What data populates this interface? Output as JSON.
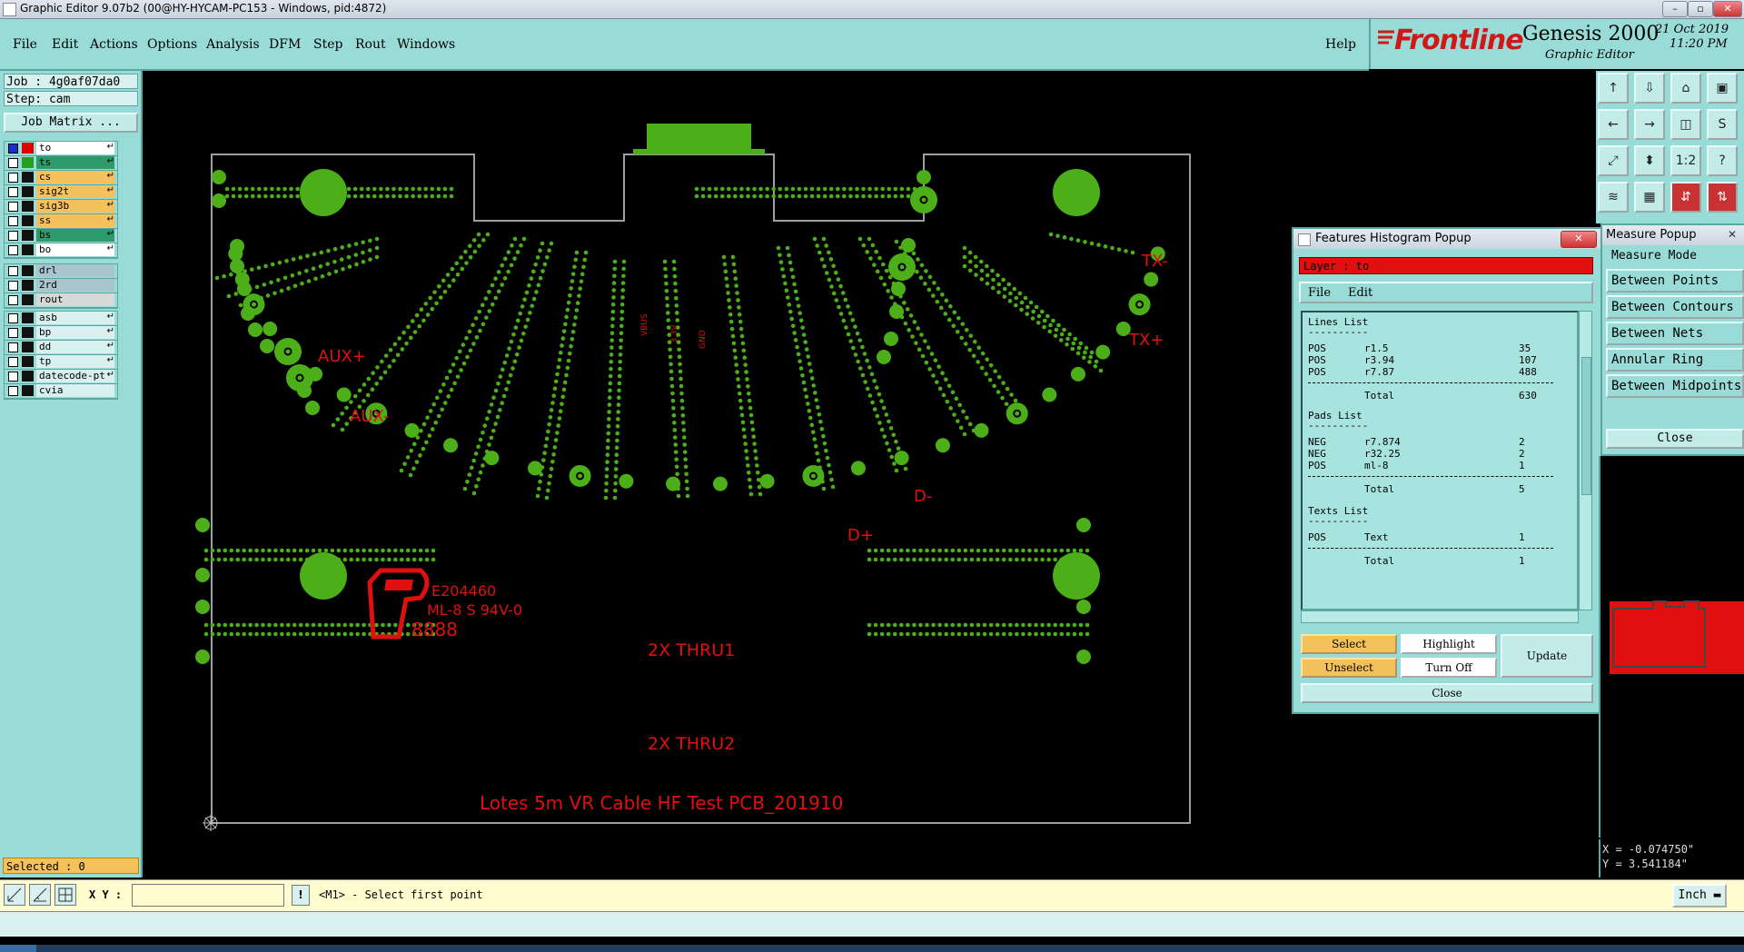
{
  "window": {
    "title": "Graphic Editor 9.07b2 (00@HY-HYCAM-PC153 - Windows, pid:4872)"
  },
  "menu": {
    "items": [
      "File",
      "Edit",
      "Actions",
      "Options",
      "Analysis",
      "DFM",
      "Step",
      "Rout",
      "Windows"
    ],
    "help": "Help"
  },
  "brand": {
    "logo": "Frontline",
    "product": "Genesis 2000",
    "subtitle": "Graphic Editor",
    "date": "21 Oct 2019",
    "time": "11:20 PM"
  },
  "left": {
    "job": "Job : 4g0af07da0",
    "step": "Step: cam",
    "job_matrix": "Job Matrix ...",
    "layers_group1": [
      {
        "name": "to",
        "color": "#ffffff",
        "swatch": "#e00000",
        "first": true
      },
      {
        "name": "ts",
        "color": "#2e9a6a",
        "swatch": "#22a022"
      },
      {
        "name": "cs",
        "color": "#f5c15a",
        "swatch": "#111111"
      },
      {
        "name": "sig2t",
        "color": "#f5c15a",
        "swatch": "#111111"
      },
      {
        "name": "sig3b",
        "color": "#f5c15a",
        "swatch": "#111111"
      },
      {
        "name": "ss",
        "color": "#f5c15a",
        "swatch": "#111111"
      },
      {
        "name": "bs",
        "color": "#2e9a6a",
        "swatch": "#111111"
      },
      {
        "name": "bo",
        "color": "#ffffff",
        "swatch": "#111111"
      }
    ],
    "layers_group2": [
      {
        "name": "drl",
        "color": "#a8c4cc",
        "swatch": "#111111"
      },
      {
        "name": "2rd",
        "color": "#a8c4cc",
        "swatch": "#111111"
      },
      {
        "name": "rout",
        "color": "#d8d8d8",
        "swatch": "#111111"
      }
    ],
    "layers_group3": [
      {
        "name": "asb",
        "color": "#d8f0ee",
        "swatch": "#111111"
      },
      {
        "name": "bp",
        "color": "#d8f0ee",
        "swatch": "#111111"
      },
      {
        "name": "dd",
        "color": "#d8f0ee",
        "swatch": "#111111"
      },
      {
        "name": "tp",
        "color": "#d8f0ee",
        "swatch": "#111111"
      },
      {
        "name": "datecode-pt",
        "color": "#d8f0ee",
        "swatch": "#111111"
      },
      {
        "name": "cvia",
        "color": "#d8f0ee",
        "swatch": "#111111"
      }
    ],
    "selected": "Selected : 0"
  },
  "board": {
    "labels": {
      "tx_minus": "TX-",
      "tx_plus": "TX+",
      "aux_plus": "AUX+",
      "aux_minus": "AUX-",
      "d_minus": "D-",
      "d_plus": "D+",
      "thru1": "2X THRU1",
      "thru2": "2X THRU2",
      "footer": "Lotes 5m VR Cable HF Test PCB_201910",
      "ul_number": "E204460",
      "ul_line2": "ML-8 S 94V-0",
      "ul_line3": "8888",
      "tiny1": "VBUS",
      "tiny2": "3.3V",
      "tiny3": "GND"
    }
  },
  "histogram": {
    "title": "Features Histogram Popup",
    "layer_label": "Layer :  to",
    "menu": [
      "File",
      "Edit"
    ],
    "lines_header": "Lines List",
    "lines": [
      {
        "pol": "POS",
        "sym": "r1.5",
        "count": "35"
      },
      {
        "pol": "POS",
        "sym": "r3.94",
        "count": "107"
      },
      {
        "pol": "POS",
        "sym": "r7.87",
        "count": "488"
      }
    ],
    "lines_total": "630",
    "pads_header": "Pads List",
    "pads": [
      {
        "pol": "NEG",
        "sym": "r7.874",
        "count": "2"
      },
      {
        "pol": "NEG",
        "sym": "r32.25",
        "count": "2"
      },
      {
        "pol": "POS",
        "sym": "ml-8",
        "count": "1"
      }
    ],
    "pads_total": "5",
    "texts_header": "Texts List",
    "texts": [
      {
        "pol": "POS",
        "sym": "Text",
        "count": "1"
      }
    ],
    "texts_total": "1",
    "total_label": "Total",
    "underline": "----------",
    "buttons": {
      "select": "Select",
      "highlight": "Highlight",
      "unselect": "Unselect",
      "turn_off": "Turn Off",
      "update": "Update",
      "close": "Close"
    }
  },
  "measure": {
    "title": "Measure Popup",
    "mode": "Measure Mode",
    "options": [
      "Between Points",
      "Between Contours",
      "Between Nets",
      "Annular Ring",
      "Between Midpoints"
    ],
    "close": "Close"
  },
  "coords": {
    "x": "X = -0.074750\"",
    "y": "Y = 3.541184\""
  },
  "status": {
    "xy_label": "X Y :",
    "xy_value": "",
    "prompt": "<M1> - Select first point",
    "units": "Inch"
  },
  "colors": {
    "panel": "#99dcd7",
    "board_copper": "#4caf1a",
    "board_text": "#e01010",
    "outline": "#9aa0a0"
  }
}
